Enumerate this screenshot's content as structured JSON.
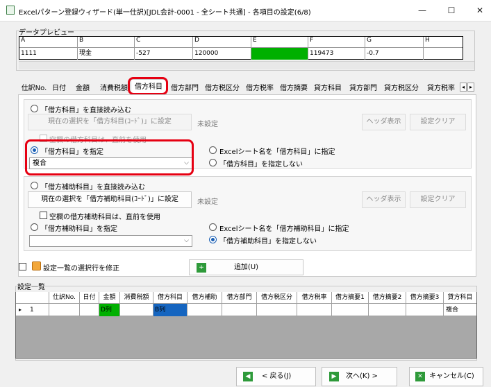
{
  "window": {
    "title": "Excelパターン登録ウィザード(単一仕訳)[JDL会計-0001 - 全シート共通] - 各項目の設定(6/8)",
    "minimize": "—",
    "maximize": "☐",
    "close": "✕"
  },
  "preview": {
    "label": "データプレビュー",
    "headers": [
      "A",
      "B",
      "C",
      "D",
      "E",
      "F",
      "G",
      "H"
    ],
    "row": [
      "1111",
      "現金",
      "-527",
      "120000",
      "",
      "119473",
      "-0.7",
      ""
    ],
    "highlight_color": "#00b000"
  },
  "tabs": {
    "items": [
      "仕訳No.",
      "日付",
      "金額",
      "消費税額",
      "借方科目",
      "借方部門",
      "借方税区分",
      "借方税率",
      "借方摘要",
      "貸方科目",
      "貸方部門",
      "貸方税区分",
      "貸方税率"
    ],
    "active": "借方科目",
    "scroll_left": "◂",
    "scroll_right": "▸"
  },
  "section1": {
    "radio_direct": "「借方科目」を直接読み込む",
    "set_button": "現在の選択を「借方科目(ｺｰﾄﾞ)」に設定",
    "unset": "未設定",
    "header_btn": "ヘッダ表示",
    "clear_btn": "設定クリア",
    "blank_check": "空欄の借方科目は、直前を使用",
    "radio_specify": "「借方科目」を指定",
    "select_value": "複合",
    "radio_sheetname": "Excelシート名を「借方科目」に指定",
    "radio_none": "「借方科目」を指定しない"
  },
  "section2": {
    "radio_direct": "「借方補助科目」を直接読み込む",
    "set_button": "現在の選択を「借方補助科目(ｺｰﾄﾞ)」に設定",
    "unset": "未設定",
    "header_btn": "ヘッダ表示",
    "clear_btn": "設定クリア",
    "blank_check": "空欄の借方補助科目は、直前を使用",
    "radio_specify": "「借方補助科目」を指定",
    "select_value": "",
    "radio_sheetname": "Excelシート名を「借方補助科目」に指定",
    "radio_none": "「借方補助科目」を指定しない"
  },
  "modify_check": "設定一覧の選択行を修正",
  "add_button": "追加(U)",
  "settings": {
    "label": "設定一覧",
    "headers": [
      "仕訳No.",
      "日付",
      "金額",
      "消費税額",
      "借方科目",
      "借方補助",
      "借方部門",
      "借方税区分",
      "借方税率",
      "借方摘要1",
      "借方摘要2",
      "借方摘要3",
      "貸方科目"
    ],
    "row_pointer": "▸",
    "row_number": "1",
    "cells": [
      "",
      "",
      "D列",
      "",
      "B列",
      "",
      "",
      "",
      "",
      "",
      "",
      "",
      "複合"
    ],
    "amount_color": "#00b000",
    "account_color": "#1565c0"
  },
  "nav": {
    "back": "< 戻る(J)",
    "next": "次へ(K) >",
    "cancel": "キャンセル(C)"
  }
}
